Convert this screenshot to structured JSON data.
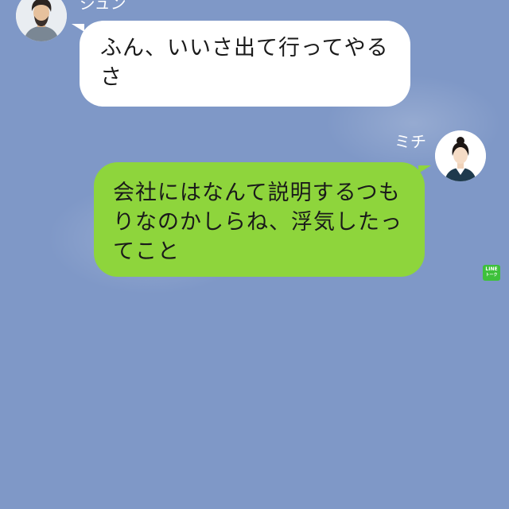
{
  "colors": {
    "background": "#7f98c7",
    "incoming_bubble": "#ffffff",
    "outgoing_bubble": "#8ed53c",
    "name_text": "#ffffff",
    "watermark": "#3ec13b"
  },
  "messages": [
    {
      "direction": "incoming",
      "sender": "ジュン",
      "avatar_icon": "man-avatar-icon",
      "text": "ふん、いいさ出て行ってやるさ"
    },
    {
      "direction": "outgoing",
      "sender": "ミチ",
      "avatar_icon": "woman-avatar-icon",
      "text": "会社にはなんて説明するつもりなのかしらね、浮気したってこと"
    }
  ],
  "watermark": {
    "line1": "LINE",
    "line2": "トーク",
    "icon": "line-logo-icon"
  }
}
